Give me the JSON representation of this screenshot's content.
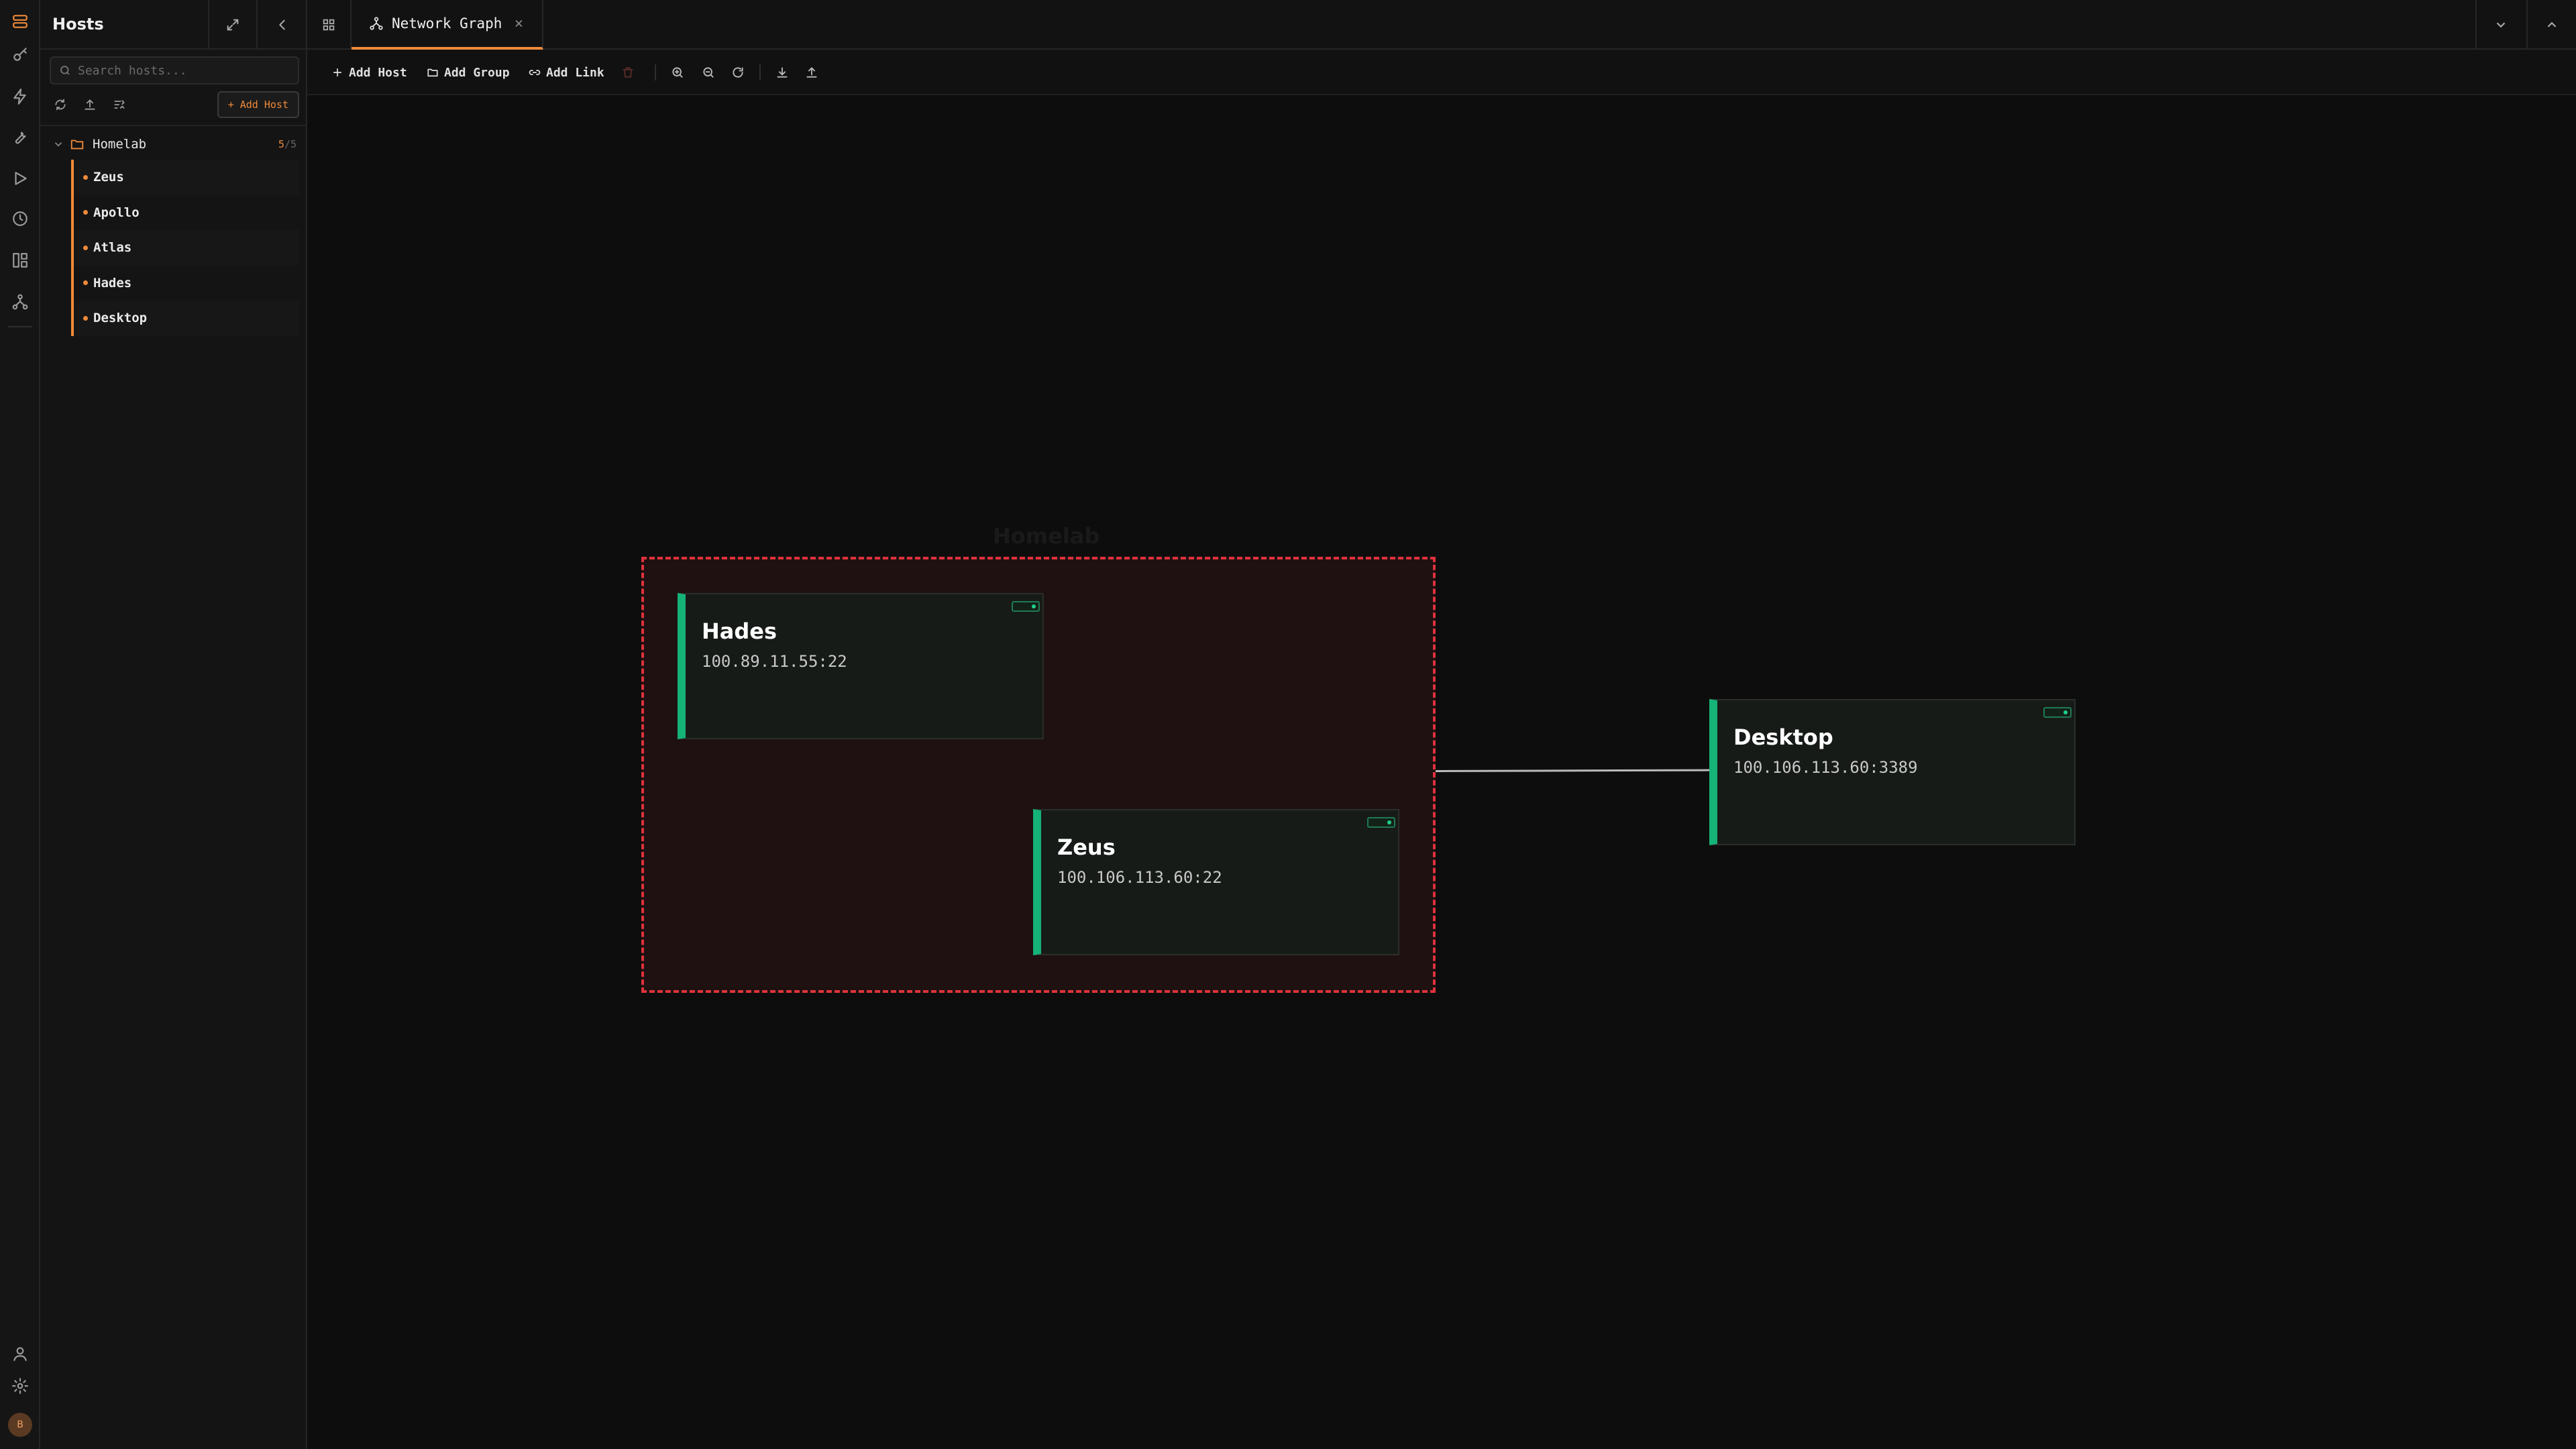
{
  "sidebar": {
    "title": "Hosts",
    "search_placeholder": "Search hosts...",
    "add_host_label": "+ Add Host",
    "group": {
      "name": "Homelab",
      "count_online": "5",
      "count_total": "/5"
    },
    "hosts": [
      {
        "label": "Zeus"
      },
      {
        "label": "Apollo"
      },
      {
        "label": "Atlas"
      },
      {
        "label": "Hades"
      },
      {
        "label": "Desktop"
      }
    ],
    "avatar_initial": "B"
  },
  "tabbar": {
    "tab_label": "Network Graph",
    "tab_close": "×"
  },
  "toolbar": {
    "add_host": "Add Host",
    "add_group": "Add Group",
    "add_link": "Add Link"
  },
  "graph": {
    "group_label": "Homelab",
    "nodes": [
      {
        "name": "Hades",
        "address": "100.89.11.55:22"
      },
      {
        "name": "Zeus",
        "address": "100.106.113.60:22"
      },
      {
        "name": "Desktop",
        "address": "100.106.113.60:3389"
      }
    ],
    "status_color": "#15b377",
    "group_border_color": "#e0323c",
    "accent_color": "#f08a3a"
  }
}
